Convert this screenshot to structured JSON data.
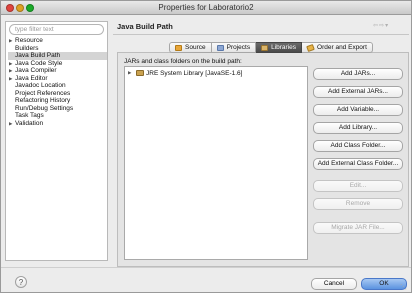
{
  "window": {
    "title": "Properties for Laboratorio2"
  },
  "filter": {
    "placeholder": "type filter text",
    "value": ""
  },
  "tree": [
    {
      "label": "Resource",
      "expandable": true
    },
    {
      "label": "Builders",
      "expandable": false
    },
    {
      "label": "Java Build Path",
      "expandable": false,
      "selected": true
    },
    {
      "label": "Java Code Style",
      "expandable": true
    },
    {
      "label": "Java Compiler",
      "expandable": true
    },
    {
      "label": "Java Editor",
      "expandable": true
    },
    {
      "label": "Javadoc Location",
      "expandable": false
    },
    {
      "label": "Project References",
      "expandable": false
    },
    {
      "label": "Refactoring History",
      "expandable": false
    },
    {
      "label": "Run/Debug Settings",
      "expandable": false
    },
    {
      "label": "Task Tags",
      "expandable": false
    },
    {
      "label": "Validation",
      "expandable": true
    }
  ],
  "page": {
    "title": "Java Build Path",
    "nav_back": "⇦",
    "nav_forward": "⇨",
    "nav_menu": "▾"
  },
  "tabs": [
    {
      "label": "Source",
      "icon": "source-folder-icon",
      "active": false
    },
    {
      "label": "Projects",
      "icon": "projects-icon",
      "active": false
    },
    {
      "label": "Libraries",
      "icon": "libraries-icon",
      "active": true
    },
    {
      "label": "Order and Export",
      "icon": "order-export-icon",
      "active": false
    }
  ],
  "libraries": {
    "label": "JARs and class folders on the build path:",
    "entries": [
      {
        "label": "JRE System Library [JavaSE-1.6]",
        "icon": "library-jar-icon"
      }
    ]
  },
  "buttons": [
    {
      "label": "Add JARs...",
      "enabled": true
    },
    {
      "label": "Add External JARs...",
      "enabled": true
    },
    {
      "label": "Add Variable...",
      "enabled": true
    },
    {
      "label": "Add Library...",
      "enabled": true
    },
    {
      "label": "Add Class Folder...",
      "enabled": true
    },
    {
      "label": "Add External Class Folder...",
      "enabled": true
    },
    {
      "label": "Edit...",
      "enabled": false
    },
    {
      "label": "Remove",
      "enabled": false
    },
    {
      "label": "Migrate JAR File...",
      "enabled": false
    }
  ],
  "footer": {
    "help": "?",
    "cancel": "Cancel",
    "ok": "OK"
  },
  "colors": {
    "ok_button": "#5b93e0",
    "active_tab": "#4a4a4a",
    "close": "#e0443e",
    "minimize": "#dea123",
    "maximize": "#1aab29"
  }
}
